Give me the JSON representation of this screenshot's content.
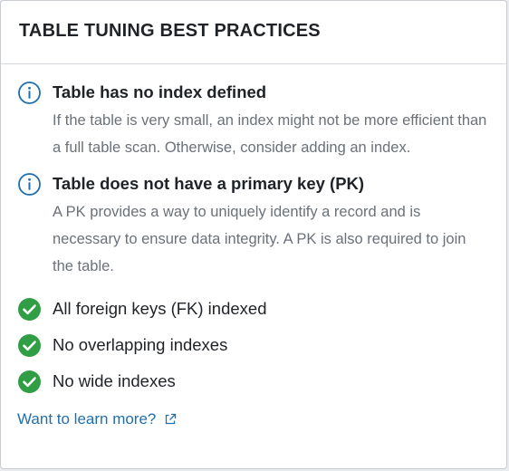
{
  "popover": {
    "title": "TABLE TUNING BEST PRACTICES"
  },
  "warnings": [
    {
      "icon": "info-icon",
      "title": "Table has no index defined",
      "description": "If the table is very small, an index might not be more efficient than a full table scan. Otherwise, consider adding an index."
    },
    {
      "icon": "info-icon",
      "title": "Table does not have a primary key (PK)",
      "description": "A PK provides a way to uniquely identify a record and is necessary to ensure data integrity. A PK is also required to join the table."
    }
  ],
  "passed": [
    {
      "icon": "check-circle-icon",
      "label": "All foreign keys (FK) indexed"
    },
    {
      "icon": "check-circle-icon",
      "label": "No overlapping indexes"
    },
    {
      "icon": "check-circle-icon",
      "label": "No wide indexes"
    }
  ],
  "learn_more": {
    "label": "Want to learn more?",
    "icon": "external-link-icon"
  },
  "colors": {
    "info_icon": "#1f6fb0",
    "check_icon": "#2f9e44",
    "link": "#1f6fb0"
  }
}
